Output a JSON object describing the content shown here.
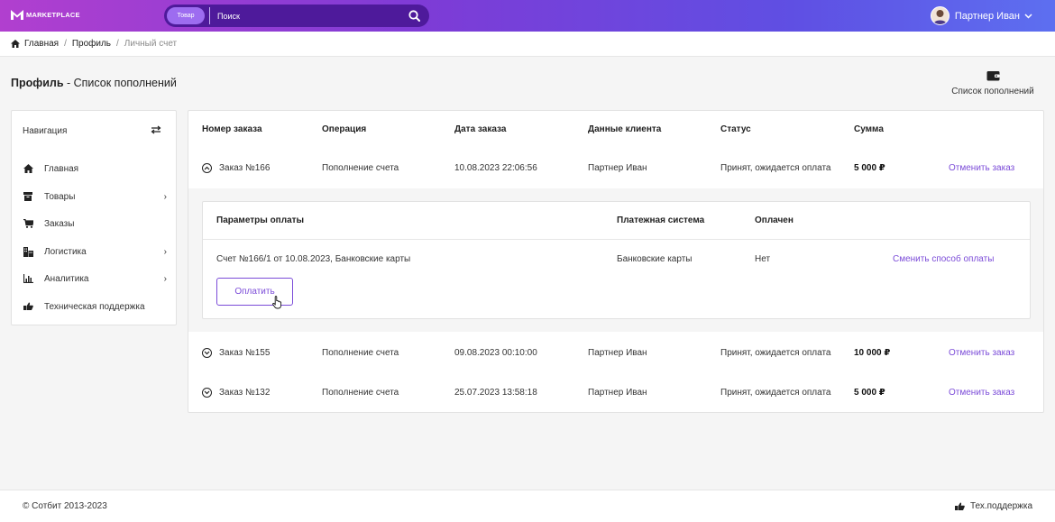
{
  "header": {
    "logo_text": "MARKETPLACE",
    "search": {
      "category": "Товар",
      "placeholder": "Поиск"
    },
    "user_name": "Партнер Иван",
    "user_chevron": "⌄"
  },
  "breadcrumb": [
    "Главная",
    "Профиль",
    "Личный счет"
  ],
  "page": {
    "title_bold": "Профиль",
    "title_rest": " - Список пополнений",
    "topup_label": "Список пополнений"
  },
  "sidebar": {
    "title": "Навигация",
    "items": [
      {
        "label": "Главная",
        "icon": "home-icon",
        "has_submenu": false
      },
      {
        "label": "Товары",
        "icon": "box-icon",
        "has_submenu": true
      },
      {
        "label": "Заказы",
        "icon": "cart-icon",
        "has_submenu": false
      },
      {
        "label": "Логистика",
        "icon": "logistics-icon",
        "has_submenu": true
      },
      {
        "label": "Аналитика",
        "icon": "analytics-icon",
        "has_submenu": true
      },
      {
        "label": "Техническая поддержка",
        "icon": "support-icon",
        "has_submenu": false
      }
    ],
    "chevron": "›"
  },
  "orders": {
    "columns": [
      "Номер заказа",
      "Операция",
      "Дата заказа",
      "Данные клиента",
      "Статус",
      "Сумма"
    ],
    "rows": [
      {
        "number": "Заказ №166",
        "operation": "Пополнение счета",
        "date": "10.08.2023 22:06:56",
        "client": "Партнер Иван",
        "status": "Принят, ожидается оплата",
        "sum": "5 000 ₽",
        "action": "Отменить заказ",
        "expanded": true
      },
      {
        "number": "Заказ №155",
        "operation": "Пополнение счета",
        "date": "09.08.2023 00:10:00",
        "client": "Партнер Иван",
        "status": "Принят, ожидается оплата",
        "sum": "10 000 ₽",
        "action": "Отменить заказ",
        "expanded": false
      },
      {
        "number": "Заказ №132",
        "operation": "Пополнение счета",
        "date": "25.07.2023 13:58:18",
        "client": "Партнер Иван",
        "status": "Принят, ожидается оплата",
        "sum": "5 000 ₽",
        "action": "Отменить заказ",
        "expanded": false
      }
    ]
  },
  "payment": {
    "columns": [
      "Параметры оплаты",
      "Платежная система",
      "Оплачен"
    ],
    "row": {
      "params": "Счет №166/1 от 10.08.2023, Банковские карты",
      "system": "Банковские карты",
      "paid": "Нет",
      "action": "Сменить способ оплаты"
    },
    "pay_button": "Оплатить"
  },
  "footer": {
    "copyright": "© Сотбит 2013-2023",
    "support": "Тех.поддержка"
  },
  "colors": {
    "accent": "#7b4bd8",
    "header_from": "#b13fcf",
    "header_to": "#5d6ff0"
  }
}
